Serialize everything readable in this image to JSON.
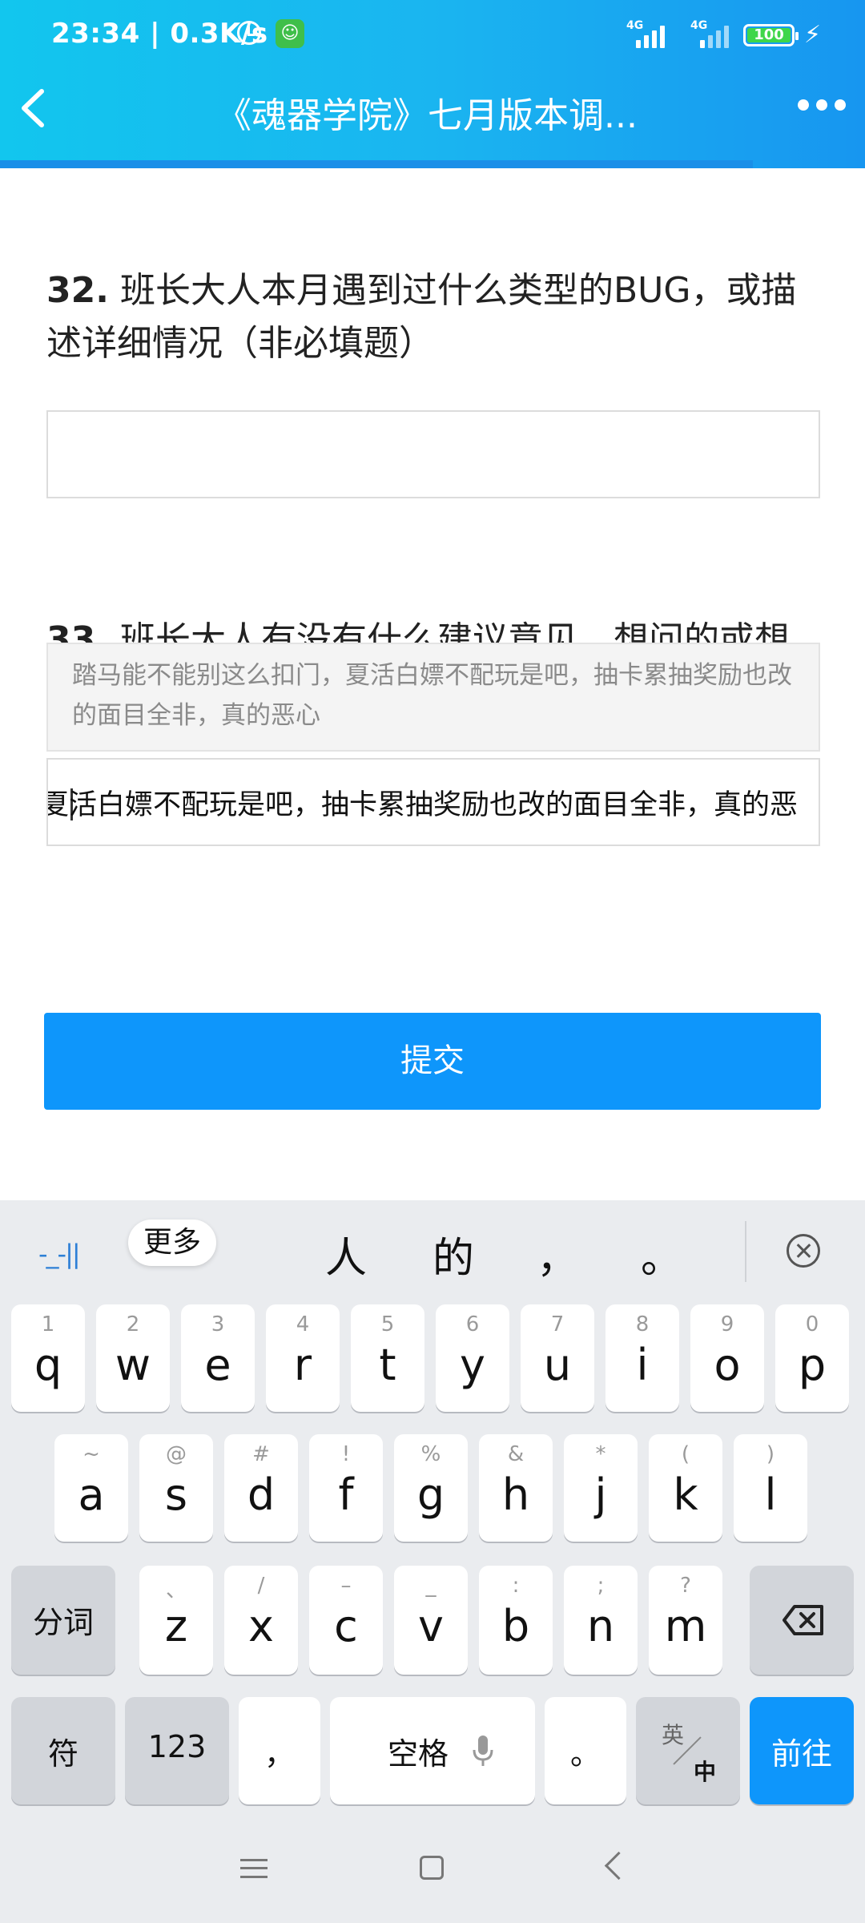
{
  "status": {
    "time_speed": "23:34 | 0.3K/s",
    "network1": "4G",
    "network2": "4G",
    "battery": "100"
  },
  "header": {
    "title": "《魂器学院》七月版本调..."
  },
  "form": {
    "q32_number": "32.",
    "q32_text": "班长大人本月遇到过什么类型的BUG，或描述详细情况（非必填题）",
    "q33_number": "33.",
    "q33_text": "班长大人有没有什么建议意见，想问的或想",
    "suggestion_text": "踏马能不能别这么扣门，夏活白嫖不配玩是吧，抽卡累抽奖励也改的面目全非，真的恶心",
    "q33_input_value": "夏活白嫖不配玩是吧，抽卡累抽奖励也改的面目全非，真的恶",
    "submit_label": "提交"
  },
  "keyboard": {
    "tool_label": "-_-||",
    "more_label": "更多",
    "candidates": [
      "人",
      "的",
      "，",
      "。"
    ],
    "row1": [
      {
        "sup": "1",
        "key": "q"
      },
      {
        "sup": "2",
        "key": "w"
      },
      {
        "sup": "3",
        "key": "e"
      },
      {
        "sup": "4",
        "key": "r"
      },
      {
        "sup": "5",
        "key": "t"
      },
      {
        "sup": "6",
        "key": "y"
      },
      {
        "sup": "7",
        "key": "u"
      },
      {
        "sup": "8",
        "key": "i"
      },
      {
        "sup": "9",
        "key": "o"
      },
      {
        "sup": "0",
        "key": "p"
      }
    ],
    "row2": [
      {
        "sup": "~",
        "key": "a"
      },
      {
        "sup": "@",
        "key": "s"
      },
      {
        "sup": "#",
        "key": "d"
      },
      {
        "sup": "!",
        "key": "f"
      },
      {
        "sup": "%",
        "key": "g"
      },
      {
        "sup": "&",
        "key": "h"
      },
      {
        "sup": "*",
        "key": "j"
      },
      {
        "sup": "(",
        "key": "k"
      },
      {
        "sup": ")",
        "key": "l"
      }
    ],
    "row3": [
      {
        "sup": "、",
        "key": "z"
      },
      {
        "sup": "/",
        "key": "x"
      },
      {
        "sup": "–",
        "key": "c"
      },
      {
        "sup": "_",
        "key": "v"
      },
      {
        "sup": ":",
        "key": "b"
      },
      {
        "sup": ";",
        "key": "n"
      },
      {
        "sup": "?",
        "key": "m"
      }
    ],
    "split_label": "分词",
    "symbol_label": "符",
    "num_label": "123",
    "comma_label": "，",
    "space_label": "空格",
    "period_label": "。",
    "lang_top": "英",
    "lang_bottom": "中",
    "go_label": "前往"
  }
}
